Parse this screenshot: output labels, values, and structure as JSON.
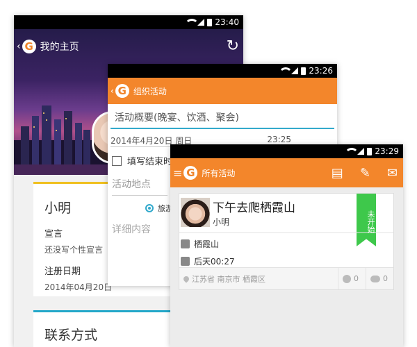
{
  "phone1": {
    "status_time": "23:40",
    "title": "我的主页",
    "profile": {
      "name": "小明",
      "motto_label": "宣言",
      "motto_value": "还没写个性宣言",
      "reg_label": "注册日期",
      "reg_value": "2014年04月20日"
    },
    "contact_title": "联系方式"
  },
  "phone2": {
    "status_time": "23:26",
    "title": "组织活动",
    "summary_placeholder": "活动概要(晚宴、饮酒、聚会)",
    "date": "2014年4月20日 周日",
    "time": "23:25",
    "end_checkbox": "填写结束时",
    "location_placeholder": "活动地点",
    "radio_label": "旅游",
    "detail_placeholder": "详细内容"
  },
  "phone3": {
    "status_time": "23:29",
    "title": "所有活动",
    "event": {
      "title": "下午去爬栖霞山",
      "user": "小明",
      "status": "未开始",
      "place": "栖霞山",
      "time": "后天00:27",
      "address": "江苏省 南京市 栖霞区",
      "joined": "0",
      "comments": "0"
    }
  },
  "colors": {
    "brand_orange": "#f3862b",
    "ribbon_green": "#3ec84b",
    "accent_blue": "#33aacc"
  }
}
